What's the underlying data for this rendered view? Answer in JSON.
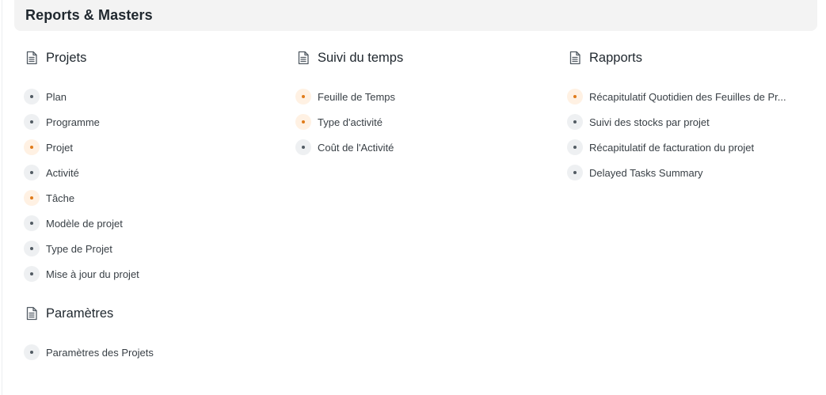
{
  "header": {
    "title": "Reports & Masters"
  },
  "colors": {
    "warm_dot": "#e07b1a",
    "neutral_dot": "#525b63",
    "header_bg": "#f3f3f3"
  },
  "cards": {
    "projets": {
      "title": "Projets",
      "icon": "document-icon",
      "links": [
        {
          "label": "Plan",
          "style": "neutral"
        },
        {
          "label": "Programme",
          "style": "neutral"
        },
        {
          "label": "Projet",
          "style": "warm"
        },
        {
          "label": "Activité",
          "style": "neutral"
        },
        {
          "label": "Tâche",
          "style": "warm"
        },
        {
          "label": "Modèle de projet",
          "style": "neutral"
        },
        {
          "label": "Type de Projet",
          "style": "neutral"
        },
        {
          "label": "Mise à jour du projet",
          "style": "neutral"
        }
      ]
    },
    "suivi": {
      "title": "Suivi du temps",
      "icon": "document-icon",
      "links": [
        {
          "label": "Feuille de Temps",
          "style": "warm"
        },
        {
          "label": "Type d'activité",
          "style": "warm"
        },
        {
          "label": "Coût de l'Activité",
          "style": "neutral"
        }
      ]
    },
    "rapports": {
      "title": "Rapports",
      "icon": "document-icon",
      "links": [
        {
          "label": "Récapitulatif Quotidien des Feuilles de Pr...",
          "style": "warm"
        },
        {
          "label": "Suivi des stocks par projet",
          "style": "neutral"
        },
        {
          "label": "Récapitulatif de facturation du projet",
          "style": "neutral"
        },
        {
          "label": "Delayed Tasks Summary",
          "style": "neutral"
        }
      ]
    },
    "parametres": {
      "title": "Paramètres",
      "icon": "document-icon",
      "links": [
        {
          "label": "Paramètres des Projets",
          "style": "neutral"
        }
      ]
    }
  }
}
